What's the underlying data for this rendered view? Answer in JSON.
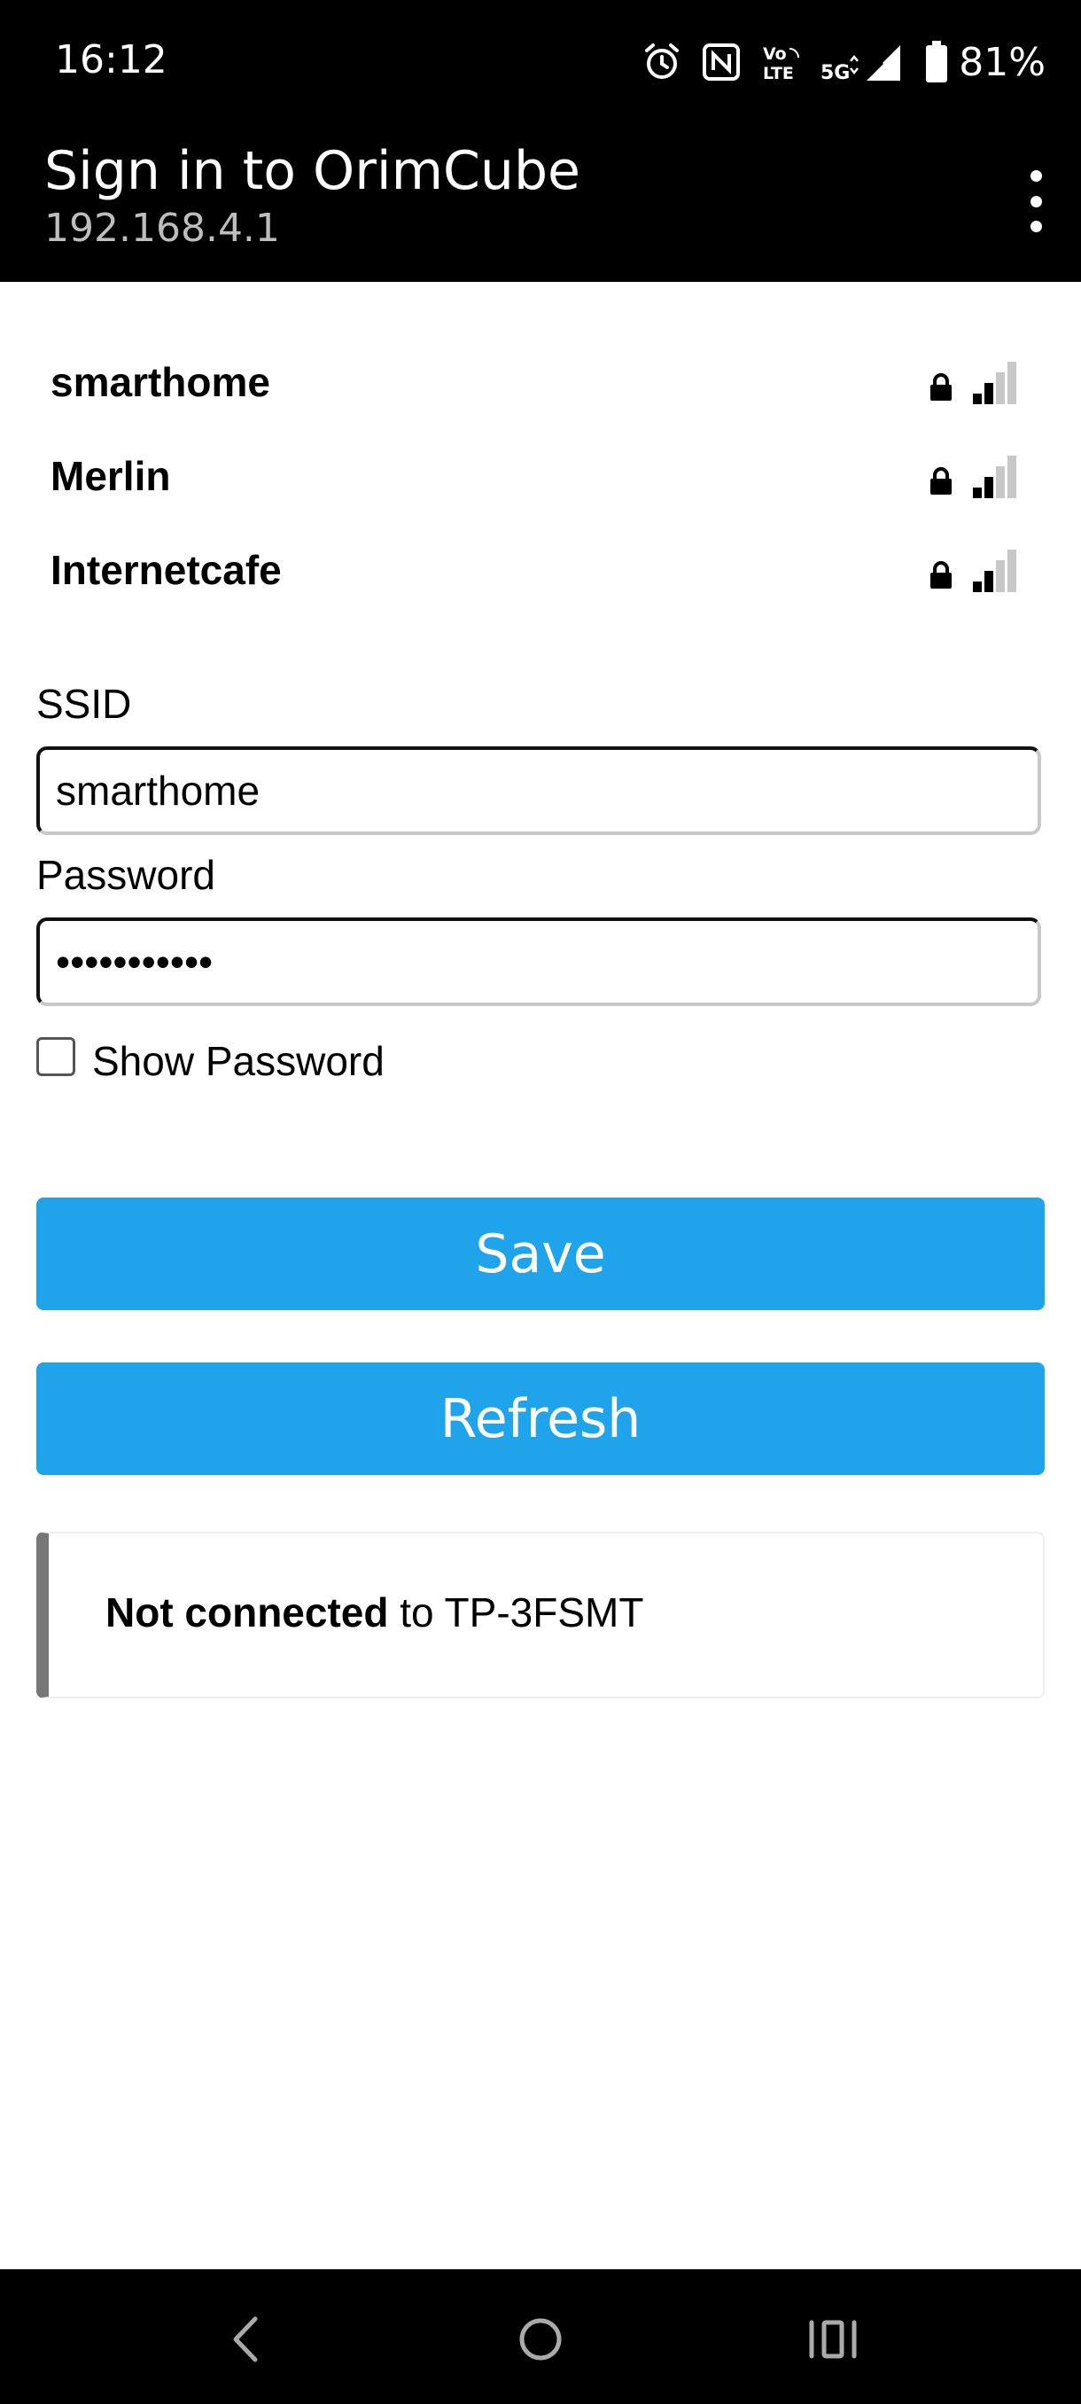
{
  "status_bar": {
    "time": "16:12",
    "battery": "81%",
    "icons": [
      "alarm-icon",
      "nfc-icon",
      "volte-icon",
      "5g-icon",
      "cell-signal-icon",
      "battery-icon"
    ],
    "volte_top": "Vo",
    "volte_bottom": "LTE",
    "network_type": "5G"
  },
  "header": {
    "title": "Sign in to OrimCube",
    "subtitle": "192.168.4.1"
  },
  "networks": [
    {
      "name": "smarthome",
      "secured": true,
      "signal_bars": 2
    },
    {
      "name": "Merlin",
      "secured": true,
      "signal_bars": 2
    },
    {
      "name": "Internetcafe",
      "secured": true,
      "signal_bars": 2
    }
  ],
  "form": {
    "ssid_label": "SSID",
    "ssid_value": "smarthome",
    "password_label": "Password",
    "password_value": "mypassword1",
    "show_password_label": "Show Password",
    "show_password_checked": false,
    "save_label": "Save",
    "refresh_label": "Refresh"
  },
  "connection": {
    "state": "Not connected",
    "text": " to TP-3FSMT"
  },
  "colors": {
    "accent": "#1fa3ea",
    "bar": "#000000"
  }
}
